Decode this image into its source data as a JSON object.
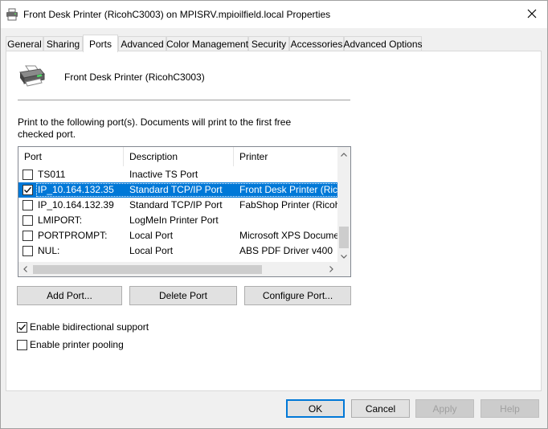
{
  "window": {
    "title": "Front Desk Printer (RicohC3003) on MPISRV.mpioilfield.local Properties",
    "close_icon": "close-icon"
  },
  "tabs": [
    {
      "label": "General"
    },
    {
      "label": "Sharing"
    },
    {
      "label": "Ports",
      "active": true
    },
    {
      "label": "Advanced"
    },
    {
      "label": "Color Management"
    },
    {
      "label": "Security"
    },
    {
      "label": "Accessories"
    },
    {
      "label": "Advanced Options"
    }
  ],
  "printer": {
    "name": "Front Desk Printer (RicohC3003)",
    "icon": "printer-icon"
  },
  "instructions": "Print to the following port(s). Documents will print to the first free checked port.",
  "ports_table": {
    "columns": [
      "Port",
      "Description",
      "Printer"
    ],
    "rows": [
      {
        "port": "TS011",
        "description": "Inactive TS Port",
        "printer": "",
        "checked": false,
        "selected": false
      },
      {
        "port": "IP_10.164.132.35",
        "description": "Standard TCP/IP Port",
        "printer": "Front Desk Printer (Rico",
        "checked": true,
        "selected": true
      },
      {
        "port": "IP_10.164.132.39",
        "description": "Standard TCP/IP Port",
        "printer": "FabShop Printer (Ricoh",
        "checked": false,
        "selected": false
      },
      {
        "port": "LMIPORT:",
        "description": "LogMeIn Printer Port",
        "printer": "",
        "checked": false,
        "selected": false
      },
      {
        "port": "PORTPROMPT:",
        "description": "Local Port",
        "printer": "Microsoft XPS Docume",
        "checked": false,
        "selected": false
      },
      {
        "port": "NUL:",
        "description": "Local Port",
        "printer": "ABS PDF Driver v400",
        "checked": false,
        "selected": false
      }
    ]
  },
  "port_buttons": {
    "add": "Add Port...",
    "delete": "Delete Port",
    "configure": "Configure Port..."
  },
  "options": {
    "bidirectional": {
      "label": "Enable bidirectional support",
      "checked": true
    },
    "pooling": {
      "label": "Enable printer pooling",
      "checked": false
    }
  },
  "dialog_buttons": {
    "ok": "OK",
    "cancel": "Cancel",
    "apply": "Apply",
    "help": "Help"
  },
  "colors": {
    "selection": "#0078d7",
    "default_button_border": "#0078d7"
  }
}
